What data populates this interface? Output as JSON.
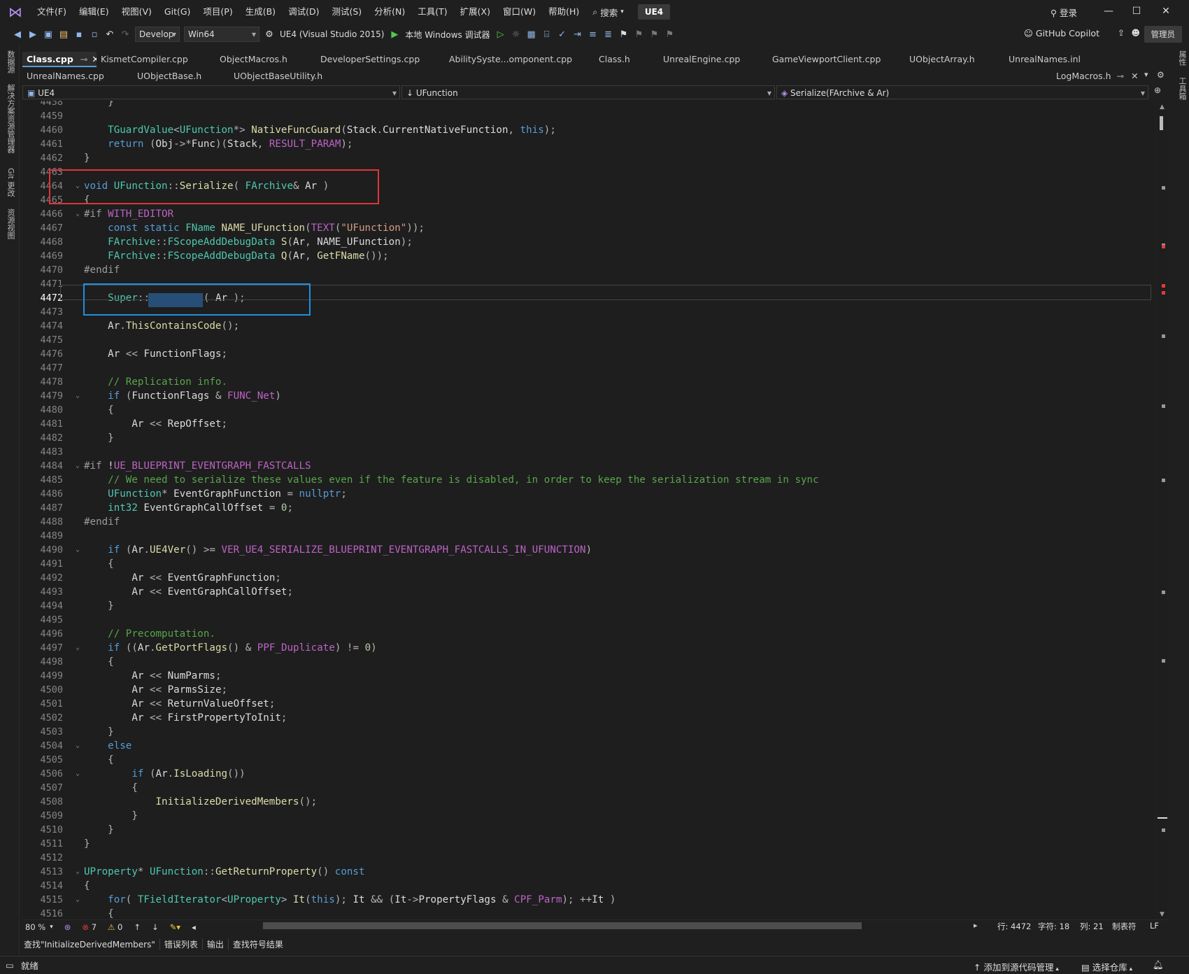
{
  "menubar": {
    "items": [
      "文件(F)",
      "编辑(E)",
      "视图(V)",
      "Git(G)",
      "项目(P)",
      "生成(B)",
      "调试(D)",
      "测试(S)",
      "分析(N)",
      "工具(T)",
      "扩展(X)",
      "窗口(W)",
      "帮助(H)"
    ],
    "search": "搜索",
    "solution": "UE4",
    "login": "登录"
  },
  "toolbar": {
    "config": "Develop",
    "platform": "Win64",
    "project": "UE4 (Visual Studio 2015)",
    "debugger": "本地 Windows 调试器",
    "copilot": "GitHub Copilot",
    "admin": "管理员"
  },
  "side_tabs": {
    "left": [
      "数据源",
      "解决方案资源管理器",
      "Git 更改",
      "资源视图"
    ],
    "right": [
      "属性",
      "工具箱"
    ]
  },
  "tabs_row1": [
    "Class.cpp",
    "KismetCompiler.cpp",
    "ObjectMacros.h",
    "DeveloperSettings.cpp",
    "AbilitySyste...omponent.cpp",
    "Class.h",
    "UnrealEngine.cpp",
    "GameViewportClient.cpp",
    "UObjectArray.h",
    "UnrealNames.inl"
  ],
  "tabs_row2": [
    "UnrealNames.cpp",
    "UObjectBase.h",
    "UObjectBaseUtility.h"
  ],
  "tab_right": "LogMacros.h",
  "navbar": {
    "project": "UE4",
    "scope": "UFunction",
    "member": "Serialize(FArchive & Ar)"
  },
  "editor": {
    "current_line": 4472,
    "lines": [
      {
        "n": "4458",
        "code": "    }"
      },
      {
        "n": "4459",
        "code": ""
      },
      {
        "n": "4460",
        "code": "    TGuardValue<UFunction*> NativeFuncGuard(Stack.CurrentNativeFunction, this);"
      },
      {
        "n": "4461",
        "code": "    return (Obj->*Func)(Stack, RESULT_PARAM);"
      },
      {
        "n": "4462",
        "code": "}"
      },
      {
        "n": "4463",
        "code": ""
      },
      {
        "n": "4464",
        "code": "void UFunction::Serialize( FArchive& Ar )"
      },
      {
        "n": "4465",
        "code": "{"
      },
      {
        "n": "4466",
        "code": "#if WITH_EDITOR"
      },
      {
        "n": "4467",
        "code": "    const static FName NAME_UFunction(TEXT(\"UFunction\"));"
      },
      {
        "n": "4468",
        "code": "    FArchive::FScopeAddDebugData S(Ar, NAME_UFunction);"
      },
      {
        "n": "4469",
        "code": "    FArchive::FScopeAddDebugData Q(Ar, GetFName());"
      },
      {
        "n": "4470",
        "code": "#endif"
      },
      {
        "n": "4471",
        "code": ""
      },
      {
        "n": "4472",
        "code": "    Super::Serialize( Ar );"
      },
      {
        "n": "4473",
        "code": ""
      },
      {
        "n": "4474",
        "code": "    Ar.ThisContainsCode();"
      },
      {
        "n": "4475",
        "code": ""
      },
      {
        "n": "4476",
        "code": "    Ar << FunctionFlags;"
      },
      {
        "n": "4477",
        "code": ""
      },
      {
        "n": "4478",
        "code": "    // Replication info."
      },
      {
        "n": "4479",
        "code": "    if (FunctionFlags & FUNC_Net)"
      },
      {
        "n": "4480",
        "code": "    {"
      },
      {
        "n": "4481",
        "code": "        Ar << RepOffset;"
      },
      {
        "n": "4482",
        "code": "    }"
      },
      {
        "n": "4483",
        "code": ""
      },
      {
        "n": "4484",
        "code": "#if !UE_BLUEPRINT_EVENTGRAPH_FASTCALLS"
      },
      {
        "n": "4485",
        "code": "    // We need to serialize these values even if the feature is disabled, in order to keep the serialization stream in sync"
      },
      {
        "n": "4486",
        "code": "    UFunction* EventGraphFunction = nullptr;"
      },
      {
        "n": "4487",
        "code": "    int32 EventGraphCallOffset = 0;"
      },
      {
        "n": "4488",
        "code": "#endif"
      },
      {
        "n": "4489",
        "code": ""
      },
      {
        "n": "4490",
        "code": "    if (Ar.UE4Ver() >= VER_UE4_SERIALIZE_BLUEPRINT_EVENTGRAPH_FASTCALLS_IN_UFUNCTION)"
      },
      {
        "n": "4491",
        "code": "    {"
      },
      {
        "n": "4492",
        "code": "        Ar << EventGraphFunction;"
      },
      {
        "n": "4493",
        "code": "        Ar << EventGraphCallOffset;"
      },
      {
        "n": "4494",
        "code": "    }"
      },
      {
        "n": "4495",
        "code": ""
      },
      {
        "n": "4496",
        "code": "    // Precomputation."
      },
      {
        "n": "4497",
        "code": "    if ((Ar.GetPortFlags() & PPF_Duplicate) != 0)"
      },
      {
        "n": "4498",
        "code": "    {"
      },
      {
        "n": "4499",
        "code": "        Ar << NumParms;"
      },
      {
        "n": "4500",
        "code": "        Ar << ParmsSize;"
      },
      {
        "n": "4501",
        "code": "        Ar << ReturnValueOffset;"
      },
      {
        "n": "4502",
        "code": "        Ar << FirstPropertyToInit;"
      },
      {
        "n": "4503",
        "code": "    }"
      },
      {
        "n": "4504",
        "code": "    else"
      },
      {
        "n": "4505",
        "code": "    {"
      },
      {
        "n": "4506",
        "code": "        if (Ar.IsLoading())"
      },
      {
        "n": "4507",
        "code": "        {"
      },
      {
        "n": "4508",
        "code": "            InitializeDerivedMembers();"
      },
      {
        "n": "4509",
        "code": "        }"
      },
      {
        "n": "4510",
        "code": "    }"
      },
      {
        "n": "4511",
        "code": "}"
      },
      {
        "n": "4512",
        "code": ""
      },
      {
        "n": "4513",
        "code": "UProperty* UFunction::GetReturnProperty() const"
      },
      {
        "n": "4514",
        "code": "{"
      },
      {
        "n": "4515",
        "code": "    for( TFieldIterator<UProperty> It(this); It && (It->PropertyFlags & CPF_Parm); ++It )"
      },
      {
        "n": "4516",
        "code": "    {"
      }
    ]
  },
  "hbar": {
    "zoom": "80 %",
    "errors": "7",
    "warnings": "0",
    "row": "行: 4472",
    "char": "字符: 18",
    "col": "列: 21",
    "tabs": "制表符",
    "eol": "LF"
  },
  "bottom_tabs": [
    "查找\"InitializeDerivedMembers\"",
    "错误列表",
    "输出",
    "查找符号结果"
  ],
  "status": {
    "ready": "就绪",
    "add_source": "添加到源代码管理",
    "select_repo": "选择仓库"
  }
}
